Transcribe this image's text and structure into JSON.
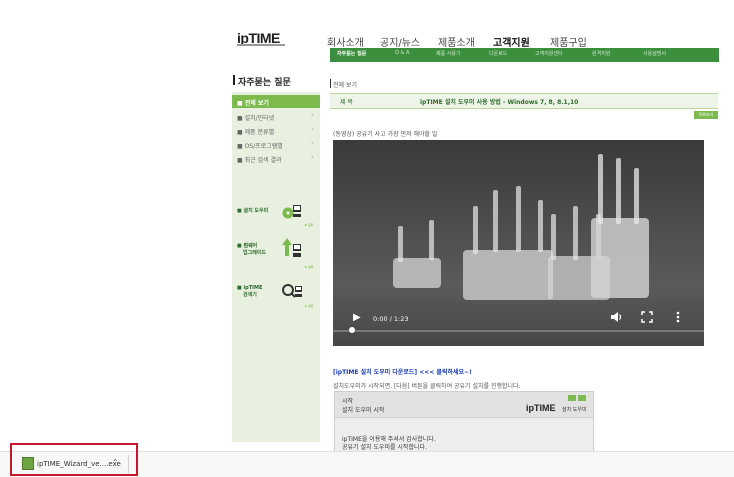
{
  "header": {
    "logo": "ipTIME",
    "nav": [
      {
        "label": "회사소개",
        "active": false
      },
      {
        "label": "공지/뉴스",
        "active": false
      },
      {
        "label": "제품소개",
        "active": false
      },
      {
        "label": "고객지원",
        "active": true
      },
      {
        "label": "제품구입",
        "active": false
      }
    ],
    "subnav": [
      {
        "label": "자주묻는 질문",
        "active": true
      },
      {
        "label": "Q & A",
        "active": false
      },
      {
        "label": "제품 사용기",
        "active": false
      },
      {
        "label": "다운로드",
        "active": false
      },
      {
        "label": "고객지원센터",
        "active": false
      },
      {
        "label": "원격지원",
        "active": false
      },
      {
        "label": "사용설명서",
        "active": false
      }
    ]
  },
  "sidebar": {
    "title": "자주묻는 질문",
    "items": [
      {
        "label": "전체 보기",
        "active": true
      },
      {
        "label": "설치/인터넷",
        "active": false
      },
      {
        "label": "제품 분류별",
        "active": false
      },
      {
        "label": "OS/프로그램별",
        "active": false
      },
      {
        "label": "최근 검색 결과",
        "active": false
      }
    ],
    "promos": [
      {
        "line1": "설치 도우미",
        "line2": ""
      },
      {
        "line1": "펌웨어",
        "line2": "업그레이드"
      },
      {
        "line1": "ipTIME",
        "line2": "검색기"
      }
    ],
    "go_label": "▸ go"
  },
  "content": {
    "breadcrumb": "전체 보기",
    "table": {
      "col_label": "제 목",
      "title": "ipTIME 설치 도우미 사용 방법 - Windows 7, 8, 8.1,10"
    },
    "list_button": "목록보기",
    "note": "(동영상) 공유기 사고 가장 먼저 해야할 일",
    "video": {
      "time": "0:00 / 1:23",
      "progress": 0
    },
    "download_link": "[ipTIME 설치 도우미 다운로드] <<< 클릭하세요~!",
    "paragraph": "설치도우미가 시작되면, [다음] 버튼을 클릭하여 공유기 설치를 진행합니다.",
    "wizard": {
      "head1": "시작",
      "head2": "설치 도우미 시작",
      "logo": "ipTIME",
      "logo_sub": "설치 도우미",
      "body1": "ipTIME을 이용해 주셔서 감사합니다.",
      "body2": "공유기 설치 도우미를 시작합니다."
    }
  },
  "download_bar": {
    "filename": "ipTIME_Wizard_ve....exe"
  },
  "colors": {
    "green": "#3c8f3c",
    "light_green": "#7cba4e",
    "highlight": "#c8192c"
  }
}
